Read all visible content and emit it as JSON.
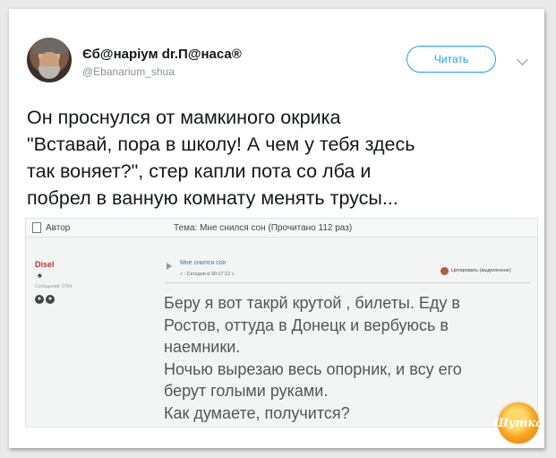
{
  "tweet": {
    "author_name": "Єб@наріум dr.П@наса®",
    "author_handle": "@Ebanarium_shua",
    "read_button": "Читать",
    "text": "Он проснулся от мамкиного окрика\n\"Вставай, пора в школу! А чем у тебя здесь\nтак воняет?\", стер капли пота со лба и\nпобрел в ванную комнату менять трусы..."
  },
  "forum": {
    "author_label": "Автор",
    "topic_label": "Тема: Мне снился сон  (Прочитано 112 раз)",
    "user_name": "Disel",
    "user_suit": "♠",
    "message_count": "Сообщений: 2764",
    "post_title": "Мне снился сон",
    "post_date": "« : Сегодня в 00:17:12 »",
    "quote_button": "Цитировать (выделенное)",
    "post_body": "Беру я вот такрй крутой , билеты. Еду в\nРостов, оттуда в Донецк и вербуюсь в\nнаемники.\nНочью вырезаю весь опорник, и всу его\nберут голыми руками.\nКак думаете, получится?"
  },
  "watermark": {
    "text": "Шутка"
  },
  "colors": {
    "accent": "#1da1f2",
    "tweet_text": "#14171a",
    "muted": "#8a9199",
    "forum_user": "#b33333",
    "forum_link": "#4a6c9a"
  },
  "icons": {
    "chevron": "chevron-down-icon",
    "forum_doc": "document-icon",
    "forum_post": "post-arrow-icon"
  }
}
